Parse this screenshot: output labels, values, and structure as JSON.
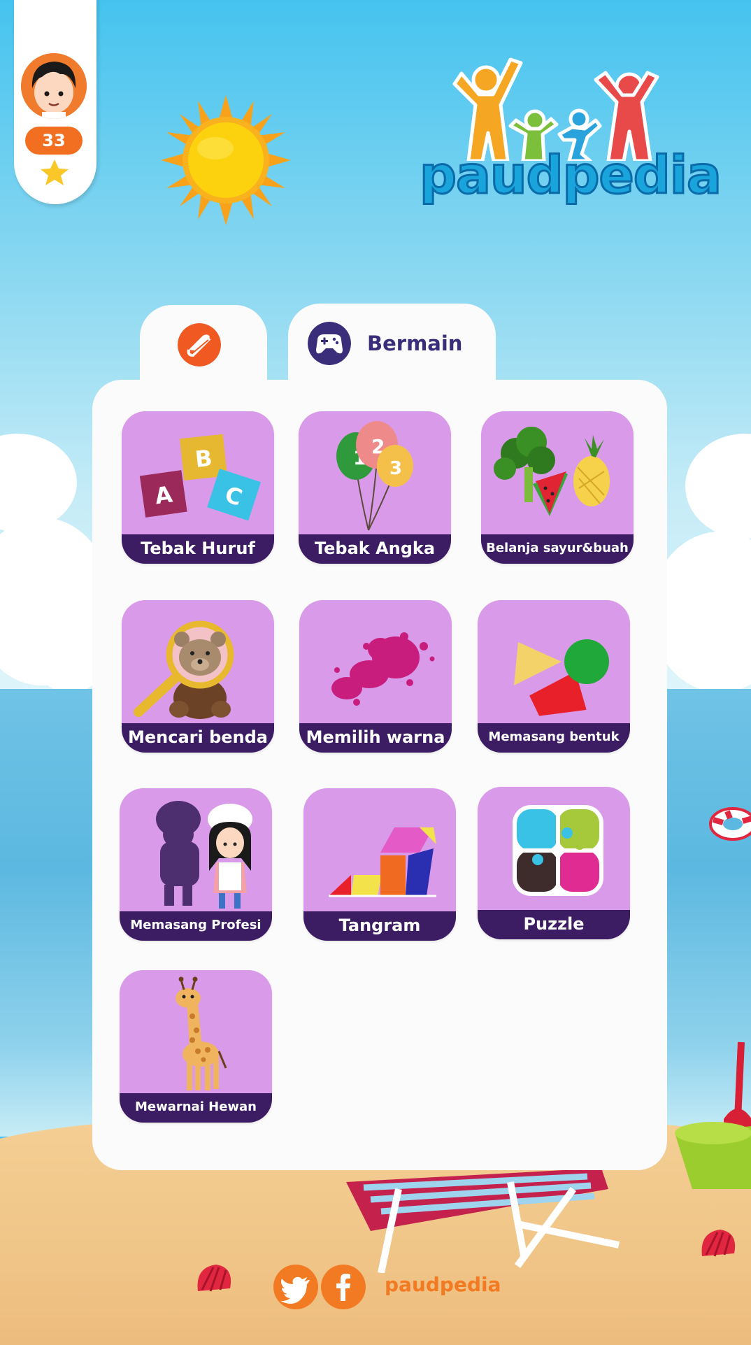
{
  "profile": {
    "score": "33"
  },
  "logo": {
    "text": "paudpedia"
  },
  "tabs": {
    "play_label": "Bermain"
  },
  "games": [
    {
      "label": "Tebak Huruf"
    },
    {
      "label": "Tebak Angka"
    },
    {
      "label": "Belanja sayur&buah"
    },
    {
      "label": "Mencari benda"
    },
    {
      "label": "Memilih warna"
    },
    {
      "label": "Memasang bentuk"
    },
    {
      "label": "Memasang Profesi"
    },
    {
      "label": "Tangram"
    },
    {
      "label": "Puzzle"
    },
    {
      "label": "Mewarnai Hewan"
    }
  ],
  "footer": {
    "brand": "paudpedia"
  },
  "colors": {
    "tile_bg": "#d99aea",
    "tile_label_bg": "#3c1c63",
    "accent_orange": "#f26f21",
    "tab_text": "#3a2d7a"
  },
  "icons": {
    "tab_learn": "book-icon",
    "tab_play": "gamepad-icon",
    "social_1": "twitter-icon",
    "social_2": "facebook-icon"
  }
}
